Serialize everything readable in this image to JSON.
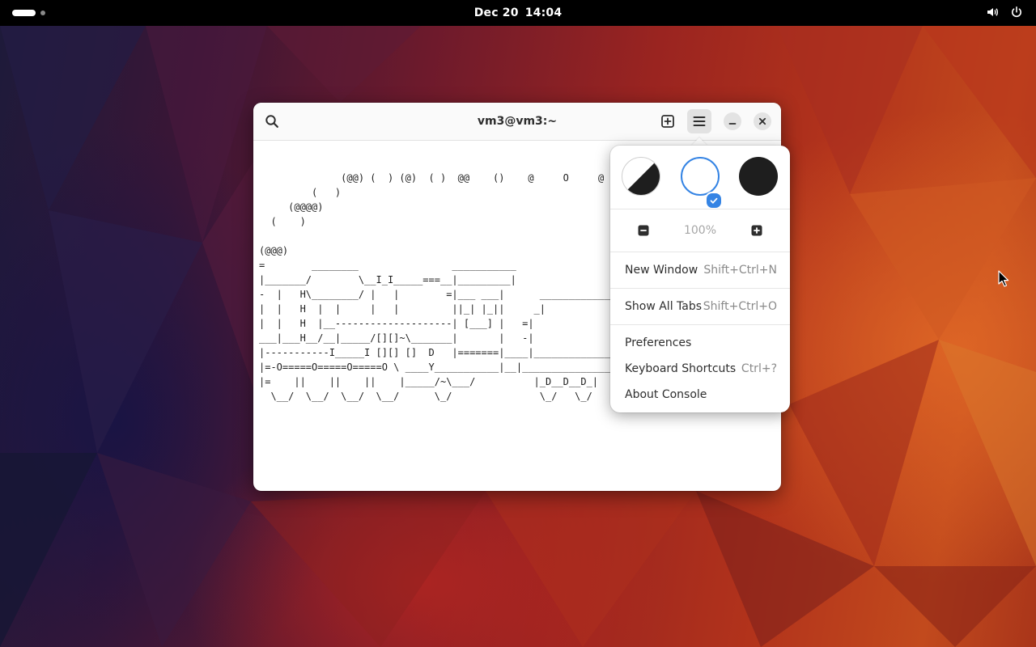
{
  "topbar": {
    "date": "Dec 20",
    "time": "14:04",
    "icons": [
      "activities-indicator",
      "volume-icon",
      "power-icon"
    ]
  },
  "window": {
    "title": "vm3@vm3:~",
    "icons": [
      "search-icon",
      "new-tab-icon",
      "hamburger-menu-icon",
      "minimize-icon",
      "close-icon"
    ],
    "terminal_lines": [
      "",
      "              (@@) (  ) (@)  ( )  @@    ()    @     O     @     O",
      "         (   )",
      "     (@@@@)",
      "  (    )",
      "",
      "(@@@)",
      "=        ________                ___________",
      "|_______/        \\__I_I_____===__|_________|",
      "-  |   H\\________/ |   |        =|___ ___|      _______________",
      "|  |   H  |  |     |   |         ||_| |_||     _|",
      "|  |   H  |__--------------------| [___] |   =|",
      "___|___H__/__|_____/[][]~\\_______|       |   -|",
      "|-----------I_____I [][] []  D   |=======|____|_________________",
      "|=-O=====O=====O=====O \\ ____Y___________|__|___________________",
      "|=    ||    ||    ||    |_____/~\\___/          |_D__D__D_|  |_D__",
      "  \\__/  \\__/  \\__/  \\__/      \\_/               \\_/   \\_/    \\_/"
    ]
  },
  "menu": {
    "themes": [
      {
        "name": "system",
        "selected": false
      },
      {
        "name": "light",
        "selected": true
      },
      {
        "name": "dark",
        "selected": false
      }
    ],
    "zoom": "100%",
    "items": [
      {
        "label": "New Window",
        "accel": "Shift+Ctrl+N"
      },
      {
        "label": "Show All Tabs",
        "accel": "Shift+Ctrl+O"
      },
      {
        "label": "Preferences",
        "accel": ""
      },
      {
        "label": "Keyboard Shortcuts",
        "accel": "Ctrl+?"
      },
      {
        "label": "About Console",
        "accel": ""
      }
    ]
  },
  "colors": {
    "accent": "#3584e4",
    "topbar": "#000000",
    "window_bg": "#ffffff"
  }
}
